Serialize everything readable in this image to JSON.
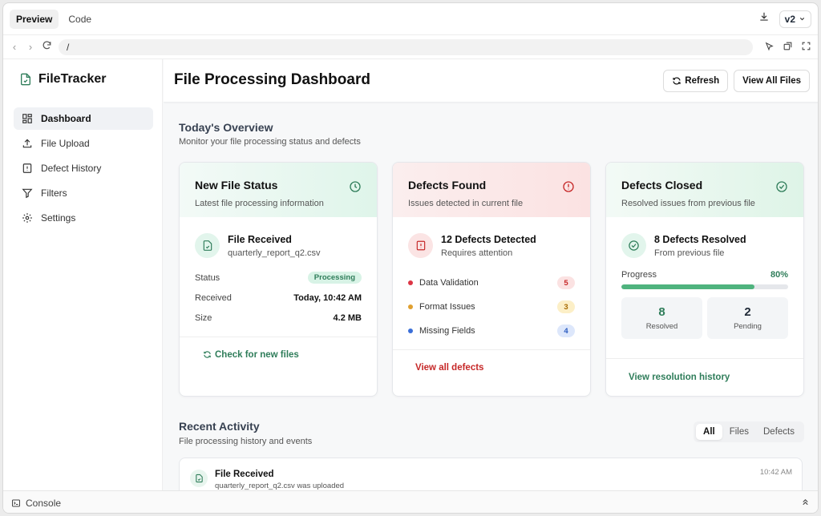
{
  "topbar": {
    "tabs": [
      "Preview",
      "Code"
    ],
    "version": "v2"
  },
  "url": {
    "path": "/"
  },
  "app": {
    "name": "FileTracker"
  },
  "sidebar": {
    "items": [
      {
        "label": "Dashboard",
        "icon": "dashboard-icon"
      },
      {
        "label": "File Upload",
        "icon": "upload-icon"
      },
      {
        "label": "Defect History",
        "icon": "alert-file-icon"
      },
      {
        "label": "Filters",
        "icon": "filter-icon"
      },
      {
        "label": "Settings",
        "icon": "gear-icon"
      }
    ]
  },
  "header": {
    "title": "File Processing Dashboard",
    "refresh": "Refresh",
    "view_all": "View All Files"
  },
  "overview": {
    "title": "Today's Overview",
    "subtitle": "Monitor your file processing status and defects"
  },
  "card_status": {
    "title": "New File Status",
    "subtitle": "Latest file processing information",
    "item_title": "File Received",
    "item_sub": "quarterly_report_q2.csv",
    "status_label": "Status",
    "status_value": "Processing",
    "received_label": "Received",
    "received_value": "Today, 10:42 AM",
    "size_label": "Size",
    "size_value": "4.2 MB",
    "action": "Check for new files"
  },
  "card_defects": {
    "title": "Defects Found",
    "subtitle": "Issues detected in current file",
    "item_title": "12 Defects Detected",
    "item_sub": "Requires attention",
    "rows": [
      {
        "label": "Data Validation",
        "count": "5",
        "color": "#dc3545"
      },
      {
        "label": "Format Issues",
        "count": "3",
        "color": "#e0a030"
      },
      {
        "label": "Missing Fields",
        "count": "4",
        "color": "#3b6fd8"
      }
    ],
    "action": "View all defects"
  },
  "card_closed": {
    "title": "Defects Closed",
    "subtitle": "Resolved issues from previous file",
    "item_title": "8 Defects Resolved",
    "item_sub": "From previous file",
    "progress_label": "Progress",
    "progress_value": "80%",
    "progress": 0.8,
    "resolved_n": "8",
    "resolved_l": "Resolved",
    "pending_n": "2",
    "pending_l": "Pending",
    "action": "View resolution history"
  },
  "activity": {
    "title": "Recent Activity",
    "subtitle": "File processing history and events",
    "tabs": [
      "All",
      "Files",
      "Defects"
    ],
    "items": [
      {
        "title": "File Received",
        "desc": "quarterly_report_q2.csv was uploaded",
        "time": "10:42 AM"
      }
    ]
  },
  "console": {
    "label": "Console"
  },
  "colors": {
    "green": "#2f7d5a",
    "red": "#c62828",
    "accent_bar": "#4fb37e"
  }
}
